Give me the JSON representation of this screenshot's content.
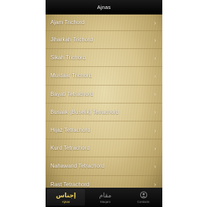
{
  "navbar": {
    "title": "Ajnas"
  },
  "list": {
    "items": [
      {
        "label": "Ajam Trichord"
      },
      {
        "label": "Jiharkah Trichord"
      },
      {
        "label": "Sikah Trichord"
      },
      {
        "label": "Mustaar Trichord"
      },
      {
        "label": "Bayati Tetrachord"
      },
      {
        "label": "Busalik (Buselik) Tetrachord"
      },
      {
        "label": "Hijaz Tetrachord"
      },
      {
        "label": "Kurd Tetrachord"
      },
      {
        "label": "Nahawand Tetrachord"
      },
      {
        "label": "Rast Tetrachord"
      }
    ],
    "chevron": "›"
  },
  "tabbar": {
    "tabs": [
      {
        "icon_text": "إجناس",
        "label": "Ajnas",
        "active": true
      },
      {
        "icon_text": "مقام",
        "label": "Maqam",
        "active": false
      },
      {
        "icon_name": "contact-icon",
        "label": "Contacts",
        "active": false
      }
    ]
  },
  "colors": {
    "accent": "#f2d35a",
    "bar_background": "#000000",
    "parchment": "#d9c68e"
  }
}
